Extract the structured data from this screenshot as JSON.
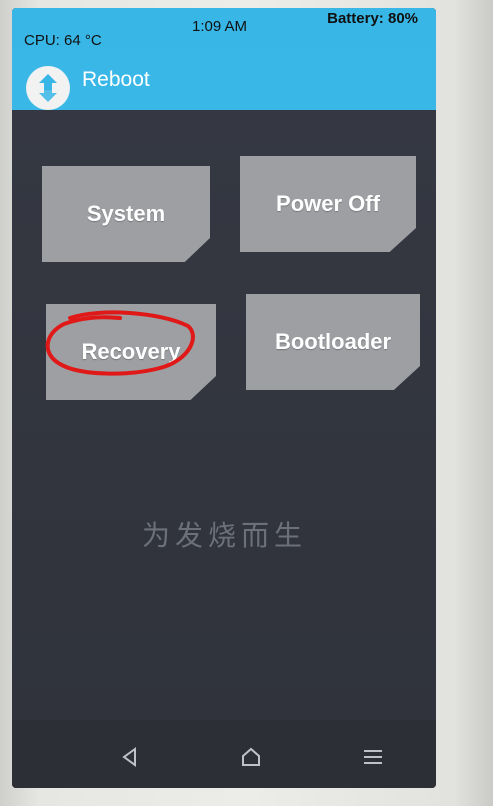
{
  "status_bar": {
    "cpu": "CPU: 64 °C",
    "time": "1:09 AM",
    "battery": "Battery: 80%"
  },
  "header": {
    "title": "Reboot",
    "logo_icon": "twrp-logo-icon"
  },
  "buttons": {
    "system": "System",
    "power_off": "Power Off",
    "recovery": "Recovery",
    "bootloader": "Bootloader"
  },
  "watermark": "为发烧而生",
  "nav": {
    "back_icon": "back-triangle-icon",
    "home_icon": "home-icon",
    "menu_icon": "menu-icon"
  },
  "colors": {
    "accent": "#38b6e6",
    "background": "#33353c",
    "button": "#9d9fa3",
    "annotation": "#e01818"
  }
}
